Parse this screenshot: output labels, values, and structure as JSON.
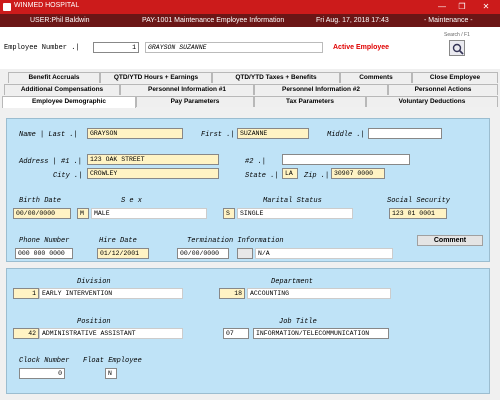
{
  "window": {
    "title": "WINMED HOSPITAL"
  },
  "status": {
    "user": "USER:Phil Baldwin",
    "screen": "PAY-1001  Maintenance Employee Information",
    "datetime": "Fri Aug. 17, 2018 17:43",
    "mode": "- Maintenance -"
  },
  "employee": {
    "label": "Employee Number .|",
    "number": "1",
    "name": "GRAYSON SUZANNE",
    "status": "Active Employee",
    "search_label": "Search / F1"
  },
  "tabs_row1": [
    "Benefit Accruals",
    "QTD/YTD Hours + Earnings",
    "QTD/YTD Taxes + Benefits",
    "Comments",
    "Close Employee"
  ],
  "tabs_row2": [
    "Additional Compensations",
    "Personnel Information #1",
    "Personnel Information #2",
    "Personnel Actions"
  ],
  "tabs_row3": [
    "Employee Demographic",
    "Pay Parameters",
    "Tax Parameters",
    "Voluntary Deductions"
  ],
  "demo": {
    "name_label": "Name |  Last .|",
    "last": "GRAYSON",
    "first_label": "First .|",
    "first": "SUZANNE",
    "middle_label": "Middle .|",
    "middle": "",
    "address_label": "Address | #1 .|",
    "addr1": "123 OAK STREET",
    "addr2_label": "#2 .|",
    "addr2": "",
    "city_label": "City .|",
    "city": "CROWLEY",
    "state_label": "State .|",
    "state": "LA",
    "zip_label": "Zip .|",
    "zip": "30907 0000",
    "birth_label": "Birth Date",
    "birth": "00/00/0000",
    "sex_label": "S e x",
    "sex_code": "M",
    "sex": "MALE",
    "marital_label": "Marital Status",
    "marital_code": "S",
    "marital": "SINGLE",
    "ssn_label": "Social Security",
    "ssn": "123 01 0001",
    "phone_label": "Phone Number",
    "phone": "000 000 0000",
    "hire_label": "Hire Date",
    "hire": "01/12/2001",
    "term_label": "Termination Information",
    "term_date": "00/00/0000",
    "term_code": "",
    "term_text": "N/A",
    "comment_btn": "Comment"
  },
  "org": {
    "division_label": "Division",
    "division_code": "1",
    "division": "EARLY INTERVENTION",
    "dept_label": "Department",
    "dept_code": "18",
    "dept": "ACCOUNTING",
    "position_label": "Position",
    "position_code": "42",
    "position": "ADMINISTRATIVE ASSISTANT",
    "job_label": "Job Title",
    "job_code": "07",
    "job": "INFORMATION/TELECOMMUNICATION",
    "clock_label": "Clock Number",
    "clock": "0",
    "float_label": "Float Employee",
    "float": "N"
  }
}
